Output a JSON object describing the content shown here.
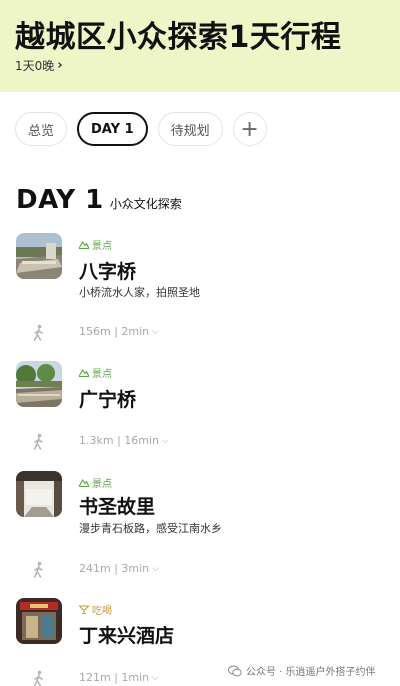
{
  "header": {
    "title": "越城区小众探索1天行程",
    "duration": "1天0晚"
  },
  "tabs": [
    {
      "label": "总览"
    },
    {
      "label": "DAY 1"
    },
    {
      "label": "待规划"
    }
  ],
  "day": {
    "title": "DAY 1",
    "subtitle": "小众文化探索"
  },
  "stops": [
    {
      "category": "景点",
      "name": "八字桥",
      "desc": "小桥流水人家，拍照圣地",
      "thumb_icon": "bridge-photo"
    },
    {
      "category": "景点",
      "name": "广宁桥",
      "desc": "",
      "thumb_icon": "bridge-photo"
    },
    {
      "category": "景点",
      "name": "书圣故里",
      "desc": "漫步青石板路，感受江南水乡",
      "thumb_icon": "old-street-photo"
    },
    {
      "category": "吃喝",
      "name": "丁来兴酒店",
      "desc": "",
      "thumb_icon": "restaurant-photo"
    }
  ],
  "transits": [
    {
      "text": "156m | 2min"
    },
    {
      "text": "1.3km | 16min"
    },
    {
      "text": "241m | 3min"
    },
    {
      "text": "121m | 1min"
    }
  ],
  "watermark": "公众号 · 乐逍遥户外搭子约伴",
  "colors": {
    "header_bg": "#eef5c6",
    "scenic": "#59a548",
    "food": "#c79a35",
    "muted": "#a8a8a8"
  }
}
